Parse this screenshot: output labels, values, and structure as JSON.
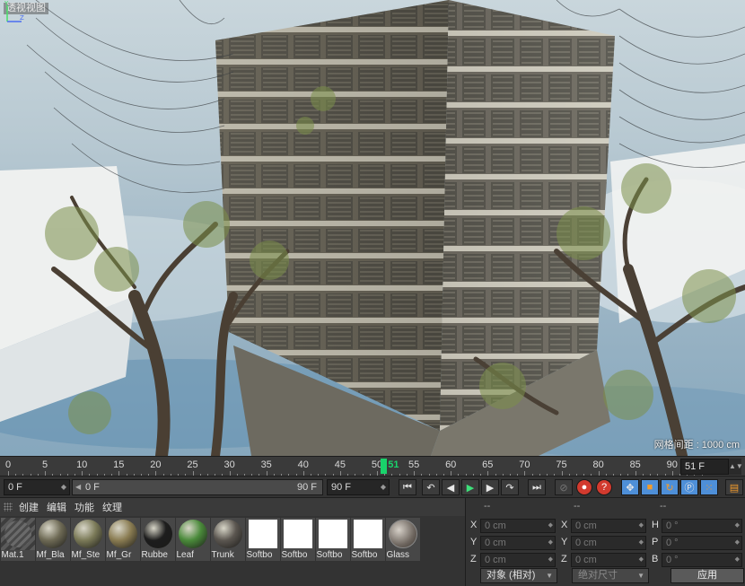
{
  "viewport": {
    "title": "透视视图",
    "grid_spacing": "网格间距 : 1000 cm"
  },
  "timeline": {
    "ticks": [
      "0",
      "5",
      "10",
      "15",
      "20",
      "25",
      "30",
      "35",
      "40",
      "45",
      "50",
      "55",
      "60",
      "65",
      "70",
      "75",
      "80",
      "85",
      "90"
    ],
    "current_frame": "51",
    "end_frame": "51 F"
  },
  "transport": {
    "start_field": "0 F",
    "range_start": "0 F",
    "range_end": "90 F",
    "max_field": "90 F"
  },
  "materials": {
    "menu": [
      "创建",
      "编辑",
      "功能",
      "纹理"
    ],
    "items": [
      {
        "label": "Mat.1",
        "kind": "default"
      },
      {
        "label": "Mf_Bla",
        "kind": "ball",
        "color": "#6e6a55"
      },
      {
        "label": "Mf_Ste",
        "kind": "ball",
        "color": "#7b7a58"
      },
      {
        "label": "Mf_Gr",
        "kind": "ball",
        "color": "#8a7c52"
      },
      {
        "label": "Rubbe",
        "kind": "ball",
        "color": "#1d1d1d"
      },
      {
        "label": "Leaf",
        "kind": "ball",
        "color": "#4a8a3a"
      },
      {
        "label": "Trunk",
        "kind": "ball",
        "color": "#5b5650"
      },
      {
        "label": "Softbo",
        "kind": "softbox"
      },
      {
        "label": "Softbo",
        "kind": "softbox"
      },
      {
        "label": "Softbo",
        "kind": "softbox"
      },
      {
        "label": "Softbo",
        "kind": "softbox"
      },
      {
        "label": "Glass",
        "kind": "glass"
      }
    ]
  },
  "coords": {
    "headers": [
      "--",
      "--",
      "--"
    ],
    "rows": [
      {
        "a_label": "X",
        "a_value": "0 cm",
        "b_label": "X",
        "b_value": "0 cm",
        "c_label": "H",
        "c_value": "0 °"
      },
      {
        "a_label": "Y",
        "a_value": "0 cm",
        "b_label": "Y",
        "b_value": "0 cm",
        "c_label": "P",
        "c_value": "0 °"
      },
      {
        "a_label": "Z",
        "a_value": "0 cm",
        "b_label": "Z",
        "b_value": "0 cm",
        "c_label": "B",
        "c_value": "0 °"
      }
    ],
    "mode_button": "对象 (相对)",
    "size_button": "绝对尺寸",
    "apply_button": "应用"
  }
}
